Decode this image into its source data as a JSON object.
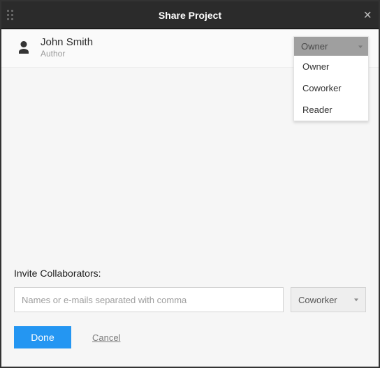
{
  "header": {
    "title": "Share Project"
  },
  "user": {
    "name": "John Smith",
    "role": "Author",
    "selected_permission": "Owner",
    "permission_options": {
      "0": "Owner",
      "1": "Coworker",
      "2": "Reader"
    }
  },
  "invite": {
    "title": "Invite Collaborators:",
    "placeholder": "Names or e-mails separated with comma",
    "role_selected": "Coworker"
  },
  "actions": {
    "done": "Done",
    "cancel": "Cancel"
  }
}
